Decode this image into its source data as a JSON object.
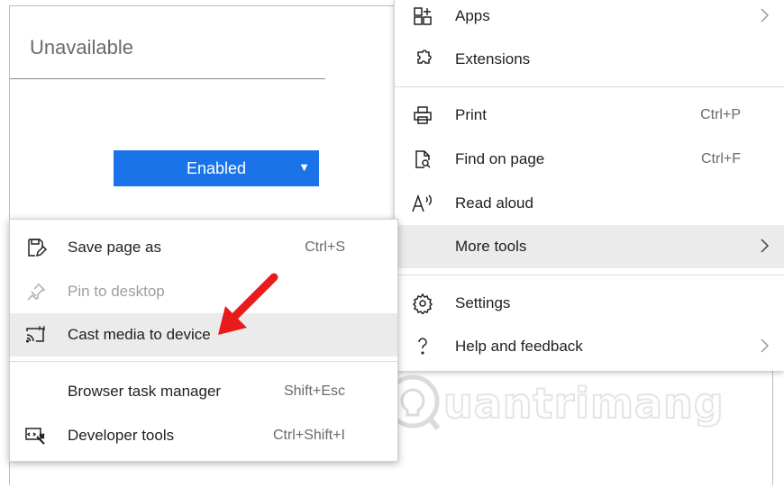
{
  "page": {
    "status_text": "Unavailable",
    "flag_button": {
      "label": "Enabled",
      "caret": "▼"
    }
  },
  "main_menu": {
    "items": [
      {
        "label": "Apps",
        "icon": "apps-icon",
        "submenu": true
      },
      {
        "label": "Extensions",
        "icon": "extensions-icon"
      },
      {
        "label": "Print",
        "icon": "print-icon",
        "shortcut": "Ctrl+P"
      },
      {
        "label": "Find on page",
        "icon": "find-icon",
        "shortcut": "Ctrl+F"
      },
      {
        "label": "Read aloud",
        "icon": "read-aloud-icon"
      },
      {
        "label": "More tools",
        "icon": "",
        "submenu": true,
        "highlighted": true
      },
      {
        "label": "Settings",
        "icon": "gear-icon"
      },
      {
        "label": "Help and feedback",
        "icon": "help-icon",
        "submenu": true
      }
    ]
  },
  "more_tools_menu": {
    "items": [
      {
        "label": "Save page as",
        "icon": "save-page-icon",
        "shortcut": "Ctrl+S"
      },
      {
        "label": "Pin to desktop",
        "icon": "pin-icon",
        "disabled": true
      },
      {
        "label": "Cast media to device",
        "icon": "cast-icon",
        "highlighted": true
      },
      {
        "label": "Browser task manager",
        "icon": "",
        "shortcut": "Shift+Esc"
      },
      {
        "label": "Developer tools",
        "icon": "developer-tools-icon",
        "shortcut": "Ctrl+Shift+I"
      }
    ]
  },
  "watermark": {
    "text": "uantrimang"
  },
  "colors": {
    "accent": "#1a73e8",
    "highlight": "#ebebeb",
    "arrow": "#e81b1b"
  }
}
